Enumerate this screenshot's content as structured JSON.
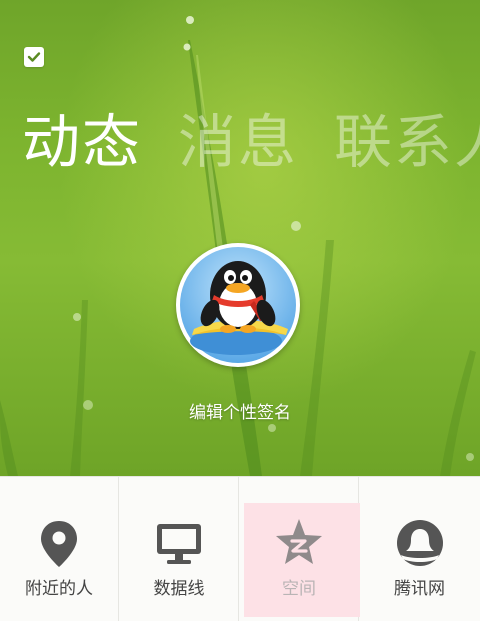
{
  "hero": {
    "checkbox_checked": true,
    "tabs": [
      {
        "label": "动态",
        "active": true
      },
      {
        "label": "消息",
        "active": false
      },
      {
        "label": "联系人",
        "active": false
      }
    ],
    "signature": "编辑个性签名"
  },
  "grid": {
    "items": [
      {
        "label": "附近的人",
        "icon": "location-pin-icon"
      },
      {
        "label": "数据线",
        "icon": "monitor-icon"
      },
      {
        "label": "空间",
        "icon": "qzone-star-icon",
        "highlighted": true
      },
      {
        "label": "腾讯网",
        "icon": "tencent-news-icon"
      }
    ]
  },
  "colors": {
    "hero_green": "#7db42f",
    "tab_active": "#ffffff",
    "highlight_pink": "#fde1e6",
    "icon_gray": "#555555"
  }
}
